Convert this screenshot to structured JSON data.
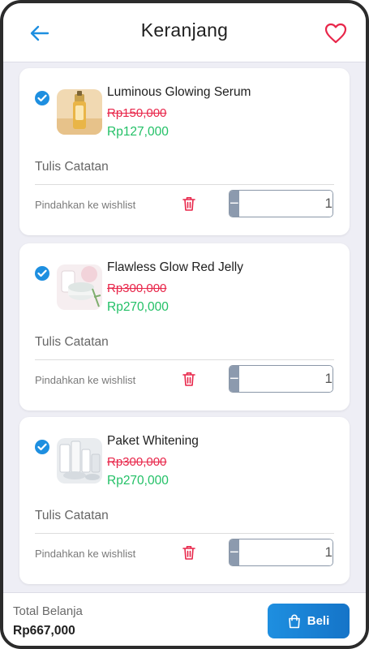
{
  "header": {
    "title": "Keranjang",
    "back_icon": "arrow-left-icon",
    "wishlist_icon": "heart-icon"
  },
  "colors": {
    "accent": "#1e8fe0",
    "old_price": "#e8264a",
    "new_price": "#22c066",
    "stepper": "#8c9aae",
    "trash": "#e8264a"
  },
  "items": [
    {
      "name": "Luminous Glowing Serum",
      "old_price": "Rp150,000",
      "new_price": "Rp127,000",
      "note": "Tulis Catatan",
      "move_label": "Pindahkan ke wishlist",
      "qty": "1",
      "checked": true
    },
    {
      "name": "Flawless Glow Red Jelly",
      "old_price": "Rp300,000",
      "new_price": "Rp270,000",
      "note": "Tulis Catatan",
      "move_label": "Pindahkan ke wishlist",
      "qty": "1",
      "checked": true
    },
    {
      "name": "Paket Whitening",
      "old_price": "Rp300,000",
      "new_price": "Rp270,000",
      "note": "Tulis Catatan",
      "move_label": "Pindahkan ke wishlist",
      "qty": "1",
      "checked": true
    }
  ],
  "stepper": {
    "minus": "−",
    "plus": "+"
  },
  "footer": {
    "total_label": "Total Belanja",
    "total_value": "Rp667,000",
    "buy_label": "Beli",
    "buy_icon": "shopping-bag-icon"
  }
}
